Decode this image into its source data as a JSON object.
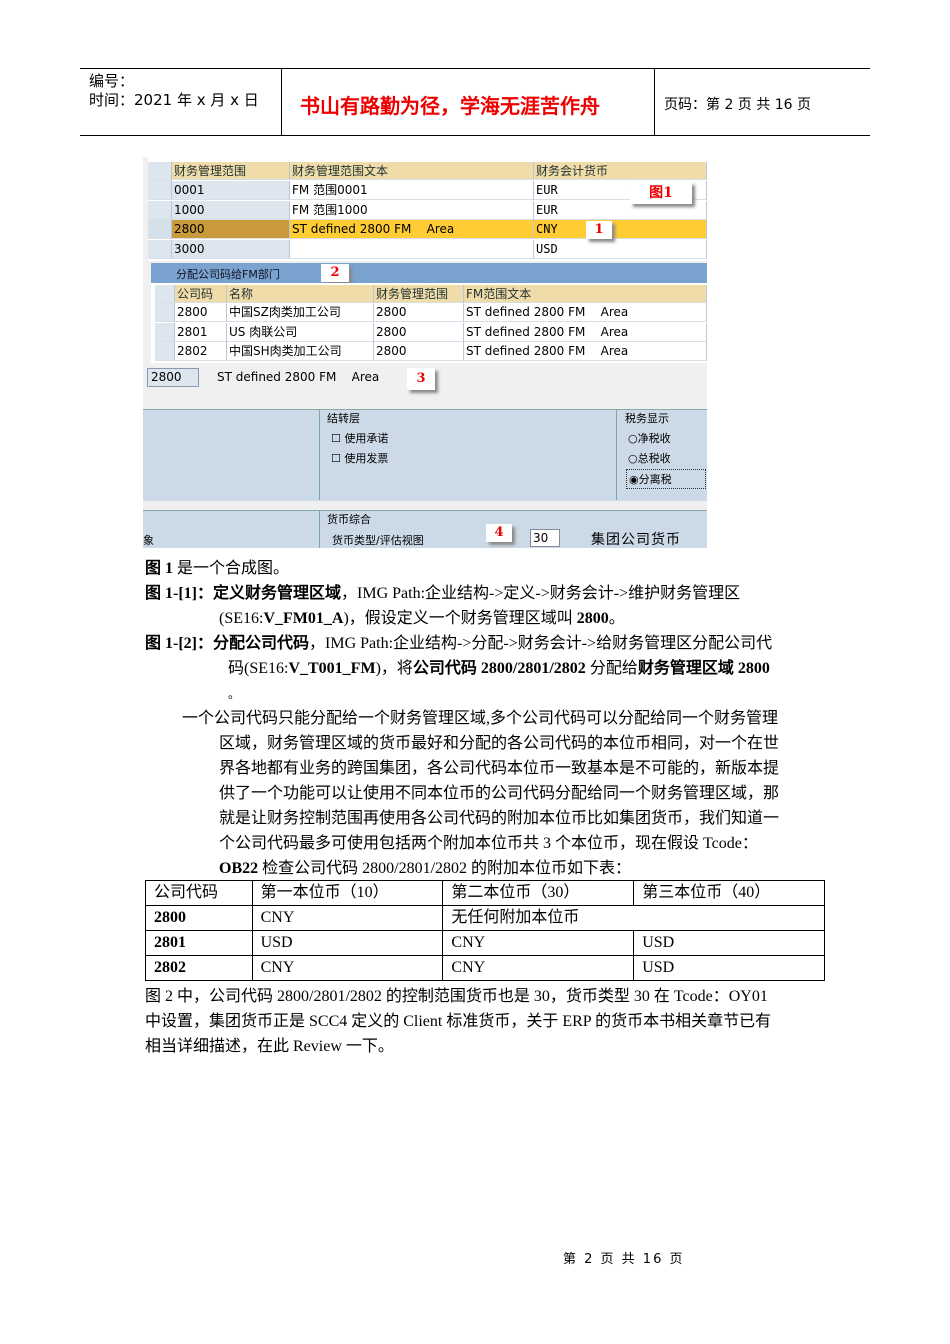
{
  "header": {
    "number_label": "编号：",
    "date_label": "时间：2021 年 x 月 x 日",
    "slogan": "书山有路勤为径，学海无涯苦作舟",
    "page_label": "页码：第 2 页  共 16 页"
  },
  "screenshot": {
    "table1": {
      "headers": [
        "财务管理范围",
        "财务管理范围文本",
        "财务会计货币"
      ],
      "rows": [
        [
          "0001",
          "FM 范围0001",
          "EUR"
        ],
        [
          "1000",
          "FM 范围1000",
          "EUR"
        ],
        [
          "2800",
          "ST defined 2800 FM    Area",
          "CNY"
        ],
        [
          "3000",
          "",
          "USD"
        ]
      ]
    },
    "callouts": [
      "图1",
      "1",
      "2",
      "3",
      "4"
    ],
    "section2_title": "分配公司码给FM部门",
    "table2": {
      "headers": [
        "公司码",
        "名称",
        "财务管理范围",
        "FM范围文本"
      ],
      "rows": [
        [
          "2800",
          "中国SZ肉类加工公司",
          "2800",
          "ST defined 2800 FM    Area"
        ],
        [
          "2801",
          "US 肉联公司",
          "2800",
          "ST defined 2800 FM    Area"
        ],
        [
          "2802",
          "中国SH肉类加工公司",
          "2800",
          "ST defined 2800 FM    Area"
        ]
      ]
    },
    "selected_code": "2800",
    "selected_text": "ST defined 2800 FM    Area",
    "carry_group": {
      "title": "结转层",
      "options": [
        "使用承诺",
        "使用发票"
      ]
    },
    "tax_group": {
      "title": "税务显示",
      "options": [
        "净税收",
        "总税收",
        "分离税"
      ],
      "selected": 2
    },
    "currency_group": {
      "title": "货币综合",
      "label": "货币类型/评估视图",
      "value": "30",
      "value_text": "集团公司货币"
    },
    "left_fragment": "象"
  },
  "paragraphs": {
    "p1_b": "图 1",
    "p1": " 是一个合成图。",
    "p2_a": "图 1-[1]：",
    "p2_b": "定义财务管理区域",
    "p2_c": "，IMG Path:企业结构->定义->财务会计->维护财务管理区",
    "p2_d": "(SE16:",
    "p2_e": "V_FM01_A",
    "p2_f": ")，假设定义一个财务管理区域叫 ",
    "p2_g": "2800",
    "p2_h": "。",
    "p3_a": "图 1-[2]：",
    "p3_b": "分配公司代码",
    "p3_c": "，IMG Path:企业结构->分配->财务会计->给财务管理区分配公司代",
    "p3_d": "码(SE16:",
    "p3_e": "V_T001_FM",
    "p3_f": ")，将",
    "p3_g": "公司代码 2800/2801/2802",
    "p3_h": " 分配给",
    "p3_i": "财务管理区域 2800",
    "p3_j": "。",
    "p4": [
      "一个公司代码只能分配给一个财务管理区域,多个公司代码可以分配给同一个财务管理",
      "区域，财务管理区域的货币最好和分配的各公司代码的本位币相同，对一个在世",
      "界各地都有业务的跨国集团，各公司代码本位币一致基本是不可能的，新版本提",
      "供了一个功能可以让使用不同本位币的公司代码分配给同一个财务管理区域，那",
      "就是让财务控制范围再使用各公司代码的附加本位币比如集团货币，我们知道一",
      "个公司代码最多可使用包括两个附加本位币共 3 个本位币，现在假设 Tcode："
    ],
    "p4_last_b": "OB22",
    "p4_last": " 检查公司代码 2800/2801/2802 的附加本位币如下表：",
    "p5": [
      "图 2 中，公司代码 2800/2801/2802 的控制范围货币也是 30，货币类型 30 在 Tcode：OY01",
      "中设置，集团货币正是 SCC4 定义的 Client 标准货币，关于 ERP 的货币本书相关章节已有",
      "相当详细描述，在此 Review 一下。"
    ]
  },
  "currency_table": {
    "headers": [
      "公司代码",
      "第一本位币（10）",
      "第二本位币（30）",
      "第三本位币（40）"
    ],
    "rows": [
      [
        "2800",
        "CNY",
        "无任何附加本位币"
      ],
      [
        "2801",
        "USD",
        "CNY",
        "USD"
      ],
      [
        "2802",
        "CNY",
        "CNY",
        "USD"
      ]
    ]
  },
  "footer": "第 2 页 共 16 页"
}
